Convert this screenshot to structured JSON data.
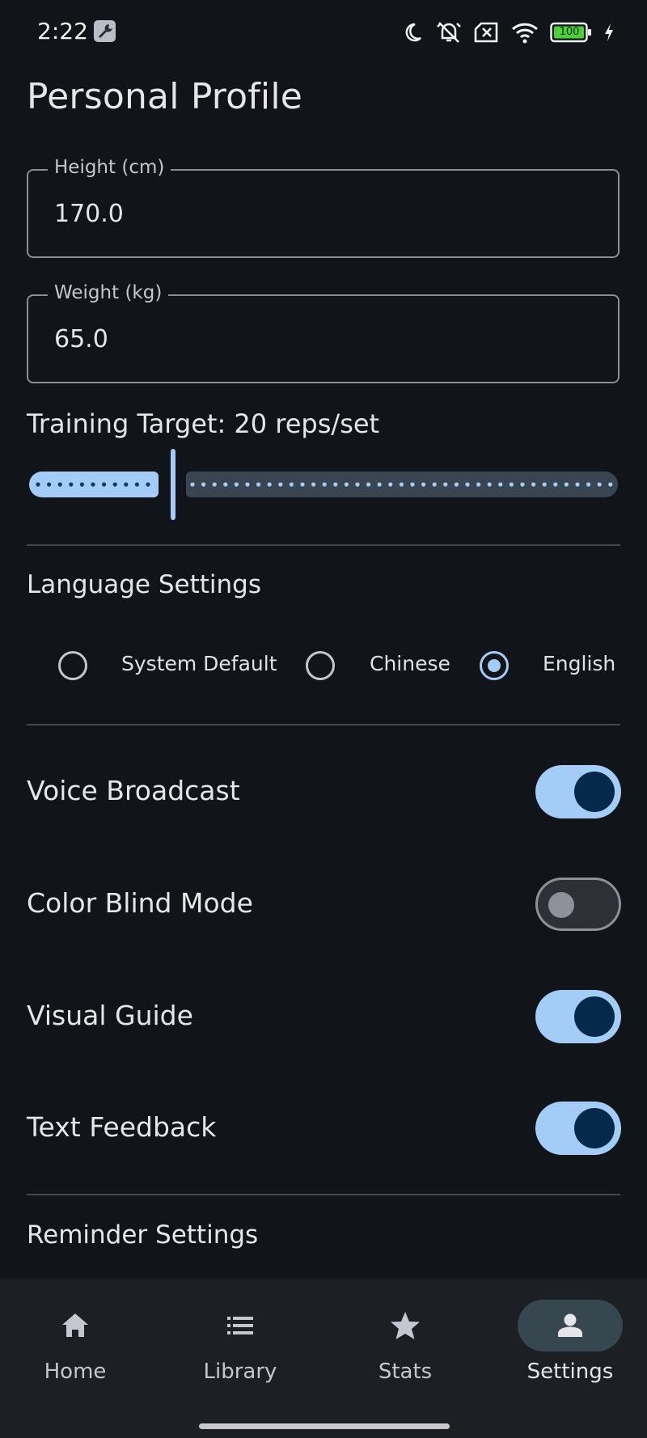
{
  "status_bar": {
    "time": "2:22",
    "battery": "100",
    "icons": [
      "wrench-icon",
      "moon-icon",
      "alarm-off-icon",
      "no-sim-icon",
      "wifi-icon",
      "battery-icon",
      "charging-icon"
    ]
  },
  "page": {
    "title": "Personal Profile"
  },
  "height_field": {
    "label": "Height (cm)",
    "value": "170.0"
  },
  "weight_field": {
    "label": "Weight (kg)",
    "value": "65.0"
  },
  "training_target": {
    "label": "Training Target: 20 reps/set",
    "value": 20,
    "slider_fraction": 0.26
  },
  "language": {
    "title": "Language Settings",
    "options": [
      "System Default",
      "Chinese",
      "English"
    ],
    "selected": "English"
  },
  "toggles": [
    {
      "label": "Voice Broadcast",
      "on": true
    },
    {
      "label": "Color Blind Mode",
      "on": false
    },
    {
      "label": "Visual Guide",
      "on": true
    },
    {
      "label": "Text Feedback",
      "on": true
    }
  ],
  "reminder": {
    "title": "Reminder Settings"
  },
  "bottom_nav": {
    "items": [
      {
        "label": "Home",
        "icon": "home-icon"
      },
      {
        "label": "Library",
        "icon": "list-icon"
      },
      {
        "label": "Stats",
        "icon": "star-icon"
      },
      {
        "label": "Settings",
        "icon": "person-icon"
      }
    ],
    "active": "Settings"
  },
  "colors": {
    "background": "#111418",
    "accent": "#a3cdf6",
    "switch_knob_on": "#04294a",
    "nav_background": "#1c2024",
    "battery_fill": "#4cd137"
  }
}
